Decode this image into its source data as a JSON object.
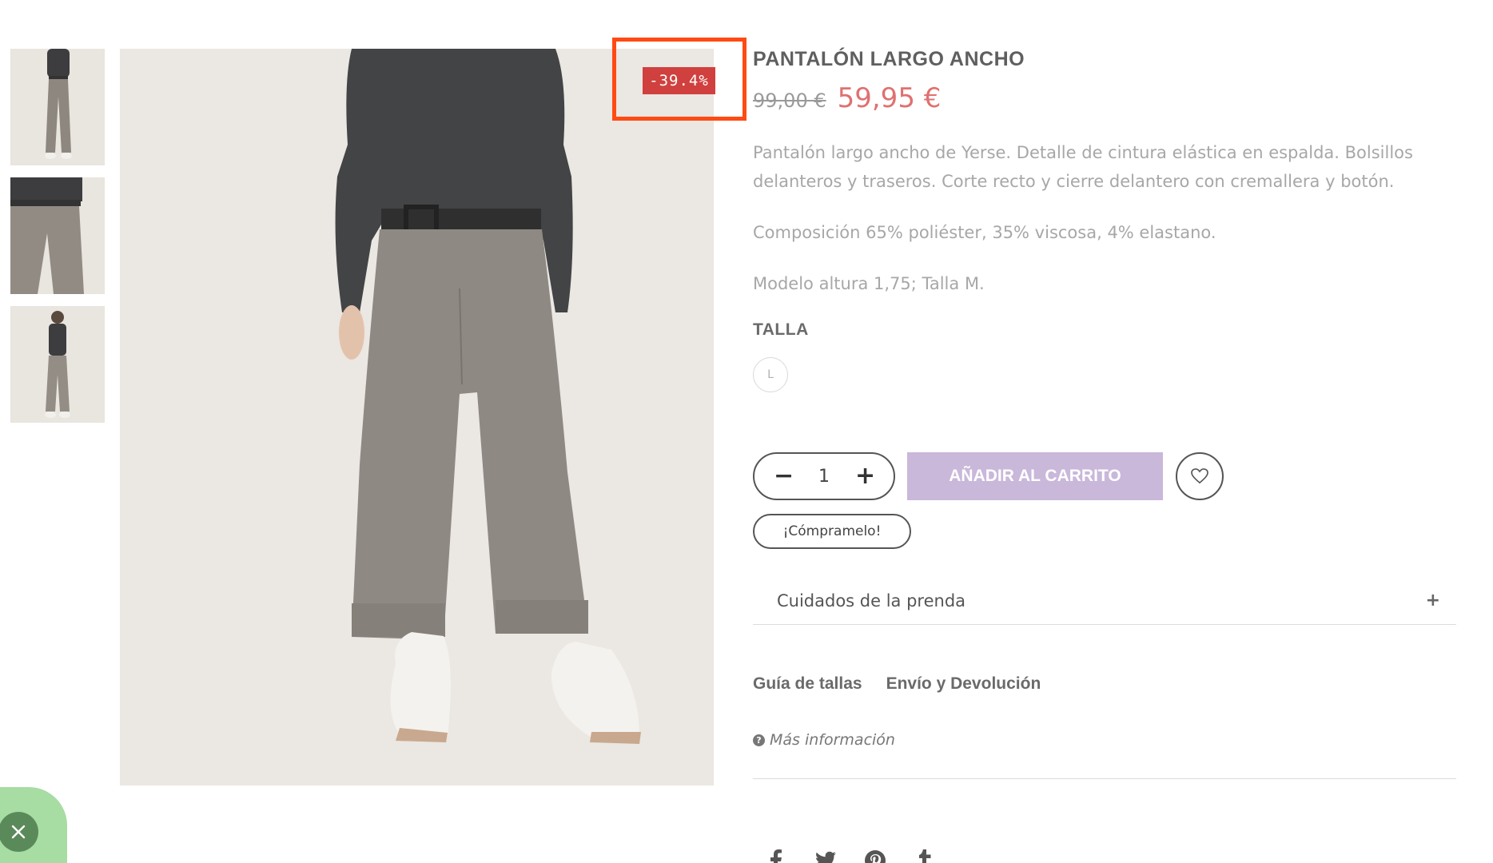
{
  "gallery": {
    "thumbnails": [
      {
        "name": "thumbnail-front"
      },
      {
        "name": "thumbnail-detail"
      },
      {
        "name": "thumbnail-back"
      }
    ],
    "discount_badge": "-39.4%"
  },
  "product": {
    "title": "PANTALÓN LARGO ANCHO",
    "old_price": "99,00 €",
    "new_price": "59,95 €",
    "description": [
      "Pantalón largo ancho de Yerse. Detalle de cintura elástica en espalda. Bolsillos delanteros y traseros. Corte recto y cierre delantero con cremallera y botón.",
      "Composición 65% poliéster, 35% viscosa, 4% elastano.",
      "Modelo altura 1,75; Talla M."
    ],
    "size_label": "TALLA",
    "sizes": [
      "L"
    ],
    "quantity": "1",
    "qty_minus": "−",
    "qty_plus": "+",
    "add_to_cart": "AÑADIR AL CARRITO",
    "buy_for_me": "¡Cómpramelo!",
    "accordion_title": "Cuidados de la prenda",
    "accordion_plus": "+",
    "links": [
      "Guía de tallas",
      "Envío y Devolución"
    ],
    "more_info": "Más información"
  },
  "colors": {
    "price_new": "#e07070",
    "price_old": "#9a9a9a",
    "add_cart_bg": "#c9b8da",
    "badge_bg": "#d0403e",
    "highlight_border": "#ff4a14",
    "chat_widget": "#a7dca3"
  },
  "icons": {
    "social": [
      "facebook-icon",
      "twitter-icon",
      "pinterest-icon",
      "tumblr-icon"
    ],
    "wishlist": "heart-icon",
    "close": "close-icon",
    "info": "question-icon"
  }
}
